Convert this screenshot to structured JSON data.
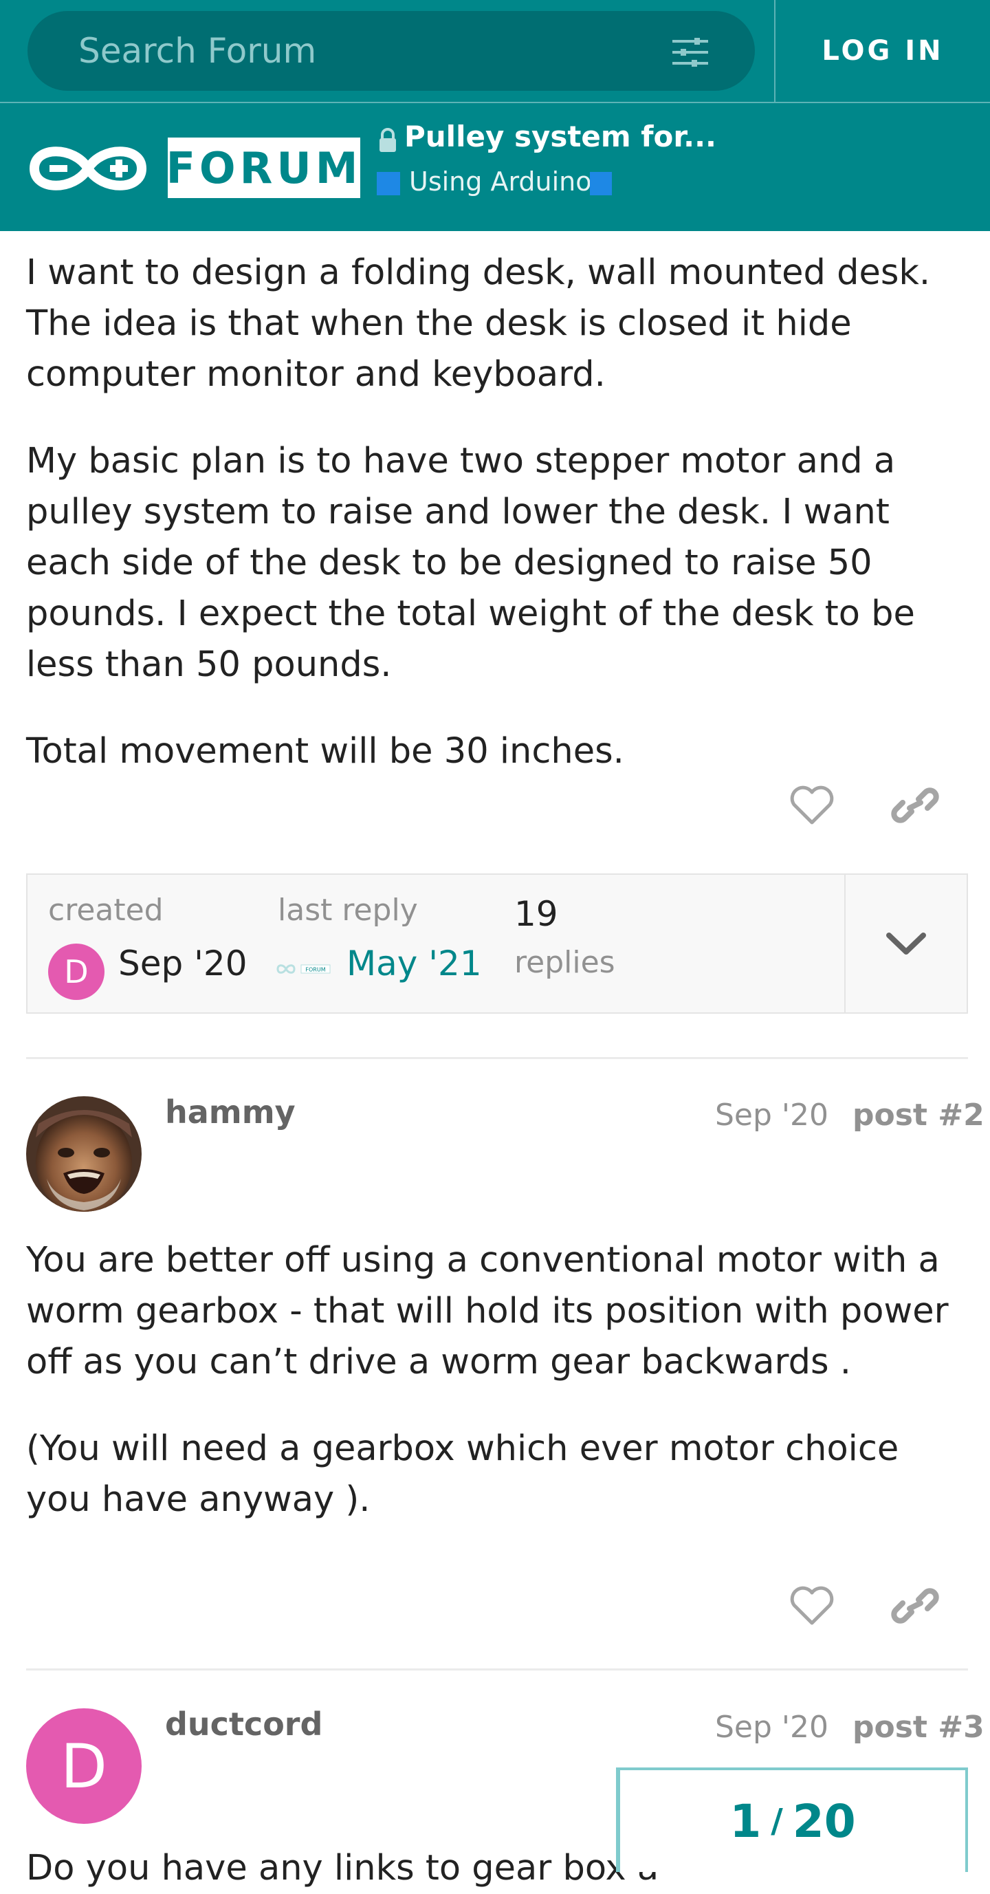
{
  "search": {
    "placeholder": "Search Forum"
  },
  "auth": {
    "login_label": "LOG IN"
  },
  "header": {
    "logo_text": "FORUM",
    "topic_title": "Pulley system for...",
    "category": "Using Arduino",
    "category_color": "#1e88e5",
    "brand_color": "#00878a"
  },
  "posts": [
    {
      "paragraphs": [
        "I want to design a folding desk, wall mounted desk. The idea is that when the desk is closed it hide computer monitor and keyboard.",
        "My basic plan is to have two stepper motor and a pulley system to raise and lower the desk. I want each side of the desk to be designed to raise 50 pounds. I expect the total weight of the desk to be less than 50 pounds.",
        "Total movement will be 30 inches."
      ]
    },
    {
      "username": "hammy",
      "date": "Sep '20",
      "post_number": "post #2",
      "paragraphs": [
        "You are better off using a conventional motor with a worm gearbox - that will hold its position with power off as you can’t drive a worm gear backwards .",
        "(You will need a gearbox which ever motor choice you have anyway )."
      ]
    },
    {
      "username": "ductcord",
      "avatar_letter": "D",
      "date": "Sep '20",
      "post_number": "post #3",
      "paragraphs": [
        "Do you have any links to gear box a"
      ]
    }
  ],
  "topic_map": {
    "created_label": "created",
    "created_avatar_letter": "D",
    "created_date": "Sep '20",
    "last_reply_label": "last reply",
    "last_reply_date": "May '21",
    "replies_count": "19",
    "replies_label": "replies"
  },
  "progress": {
    "current": "1",
    "total": "20"
  },
  "icons": {
    "filter": "sliders-icon",
    "like": "heart-icon",
    "share": "link-icon",
    "expand": "chevron-down-icon",
    "lock": "lock-icon"
  }
}
